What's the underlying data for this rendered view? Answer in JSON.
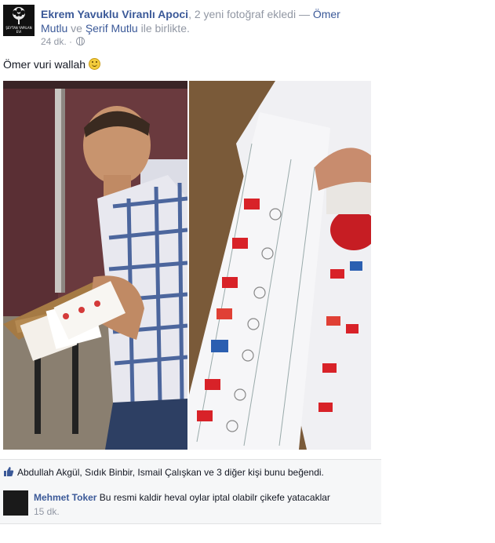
{
  "post": {
    "author": "Ekrem Yavuklu Viranlı Apoci",
    "action_prefix": ", 2 yeni fotoğraf ",
    "action_verb": "ekledi — ",
    "tag1": "Ömer Mutlu",
    "tag_joiner": " ve ",
    "tag2": "Şerif Mutlu",
    "tag_suffix": " ile birlikte.",
    "time": "24 dk. · ",
    "privacy_icon": "globe-icon",
    "message": "Ömer vuri wallah ",
    "emoji_icon": "smile-emoji-icon",
    "avatar_caption": "ŞEYTAN YAPILAN EVI"
  },
  "likes": {
    "icon": "thumbs-up-icon",
    "text": "Abdullah Akgül, Sıdık Binbir, Ismail Çalışkan ve 3 diğer kişi bunu beğendi."
  },
  "comment": {
    "author": "Mehmet Toker",
    "text": " Bu resmi kaldir heval oylar iptal olabilr çikefe yatacaklar",
    "time": "15 dk."
  },
  "colors": {
    "link": "#3b5998",
    "meta": "#9197a3",
    "bar_bg": "#f6f7f8"
  }
}
